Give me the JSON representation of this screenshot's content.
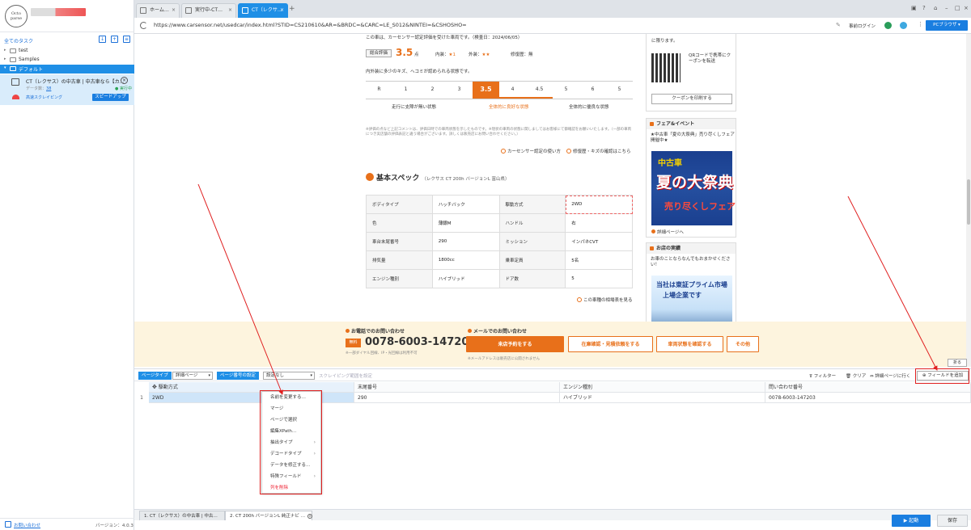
{
  "left_panel": {
    "logo_text": "Octo parse",
    "all_tasks": "全てのタスク",
    "folders": [
      {
        "label": "test"
      },
      {
        "label": "Samples"
      },
      {
        "label": "デフォルト"
      }
    ],
    "task": {
      "title": "CT（レクサス）の中古車 | 中古車なら【カ…",
      "data_label": "データ数：",
      "data_count": "38",
      "status": "● 実行中",
      "mode": "高速スクレイピング",
      "speedup": "スピードアップ"
    },
    "help": "お問い合わせ",
    "version": "バージョン：4.0.3"
  },
  "browser": {
    "tabs": [
      {
        "label": "ホーム…"
      },
      {
        "label": "実行中-CT…"
      },
      {
        "label": "CT（レクサ…"
      }
    ],
    "url": "https://www.carsensor.net/usedcar/index.html?STID=CS210610&AR=&BRDC=&CARC=LE_S012&NINTEI=&CSHOSHO=",
    "pre_login": "事前ログイン",
    "pc_browser": "PCブラウザ ▾"
  },
  "web": {
    "cert_note": "この車は、カーセンサー認定評価を受けた車両です。（検査日：2024/06/05）",
    "overall_label": "総合評価",
    "score": "3.5",
    "score_unit": "点",
    "interior": "内装：",
    "interior_stars": "★1",
    "exterior": "外装：",
    "exterior_stars": "★★",
    "repair": "修復歴：無",
    "cond_note": "内外装に多少のキズ、ヘコミが認められる状態です。",
    "grades": [
      "R",
      "1",
      "2",
      "3",
      "3.5",
      "4",
      "4.5",
      "5",
      "6",
      "5"
    ],
    "grade_desc": [
      "走行に支障が無い状態",
      "全体的に良好な状態",
      "全体的に優良な状態"
    ],
    "fine_print": "※評価の点など上記コメントは、評価日時での車両状態を示したものです。※現状の車両の状態に関しましてはお客様にて御確認をお願いいたします。（一部の車両につき実店舗の評価表記と違う場合がございます。詳しくは販売店にお問い合わせください。）",
    "link_cert": "カーセンサー認定の使い方",
    "link_repair": "修復歴・キズの確認はこちら",
    "spec_title": "基本スペック",
    "spec_sub": "（レクサス CT 200h バージョンL 富山県）",
    "spec_rows": [
      [
        {
          "h": "ボディタイプ"
        },
        {
          "v": "ハッチバック"
        },
        {
          "h": "駆動方式"
        },
        {
          "v": "2WD"
        }
      ],
      [
        {
          "h": "色"
        },
        {
          "v": "薄銀M"
        },
        {
          "h": "ハンドル"
        },
        {
          "v": "右"
        }
      ],
      [
        {
          "h": "車台末尾番号"
        },
        {
          "v": "290"
        },
        {
          "h": "ミッション"
        },
        {
          "v": "インパネCVT"
        }
      ],
      [
        {
          "h": "排気量"
        },
        {
          "v": "1800cc"
        },
        {
          "h": "乗車定員"
        },
        {
          "v": "5名"
        }
      ],
      [
        {
          "h": "エンジン種別"
        },
        {
          "v": "ハイブリッド"
        },
        {
          "h": "ドア数"
        },
        {
          "v": "5"
        }
      ]
    ],
    "compare_link": "この車種の相場表を見る",
    "sidebar": {
      "card1_text": "に限ります。",
      "qr_text": "QRコードで携帯にクーポンを転送",
      "coupon_btn": "クーポンを印刷する",
      "fair_title": "フェア&イベント",
      "fair_text": "★中古車「夏の大祭典」売り尽くしフェア開催中★",
      "fair_b1": "中古車",
      "fair_b2": "夏の大祭典",
      "fair_b3": "売り尽くしフェア",
      "fair_detail": "詳細ページへ",
      "store_title": "お店の実績",
      "store_text": "お車のことならなんでもおまかせください！",
      "store_b1": "当社は東証プライム市場",
      "store_b2": "上場企業です"
    },
    "contact": {
      "phone_label": "お電話でのお問い合わせ",
      "free": "無料",
      "phone": "0078-6003-147203",
      "phone_note": "※一部ダイヤル回線、IP・光回線は利用不可",
      "mail_label": "メールでのお問い合わせ",
      "btn_visit": "来店予約をする",
      "btn_stock": "在庫確認・見積依頼をする",
      "btn_condition": "車両状態を確認する",
      "btn_other": "その他",
      "mail_note": "※メールアドレスは販売店に公開されません"
    }
  },
  "lower": {
    "fold": "折る",
    "page_type_label": "ページタイプ",
    "page_type_value": "詳細ページ",
    "page_num_label": "ページ番号の設定",
    "page_num_value": "設定なし",
    "scroll_setting": "スクレイピング範囲を設定",
    "filter": "フィルター",
    "clear": "クリア",
    "goto_detail": "詳細ページに行く",
    "add_field": "フィールドを追加",
    "columns": [
      "駆動方式",
      "末尾番号",
      "エンジン種別",
      "問い合わせ番号"
    ],
    "row": {
      "num": "1",
      "cells": [
        "2WD",
        "290",
        "ハイブリッド",
        "0078-6003-147203"
      ]
    },
    "context_menu": [
      {
        "label": "名前を変更する…"
      },
      {
        "label": "マージ"
      },
      {
        "label": "ページで選択"
      },
      {
        "label": "編集XPath…"
      },
      {
        "label": "抽出タイプ"
      },
      {
        "label": "デコードタイプ"
      },
      {
        "label": "データを修正する…"
      },
      {
        "label": "特殊フィールド"
      },
      {
        "label": "列を削除"
      }
    ],
    "bottom_tabs": [
      {
        "label": "1. CT（レクサス）の中古車 | 中古…"
      },
      {
        "label": "2. CT 200h バージョンL 純正ナビ …"
      }
    ],
    "start": "▶ 起動",
    "save": "保存"
  },
  "colors": {
    "accent": "#1f8fe6",
    "orange": "#e8701a",
    "annotation": "#e02020"
  }
}
